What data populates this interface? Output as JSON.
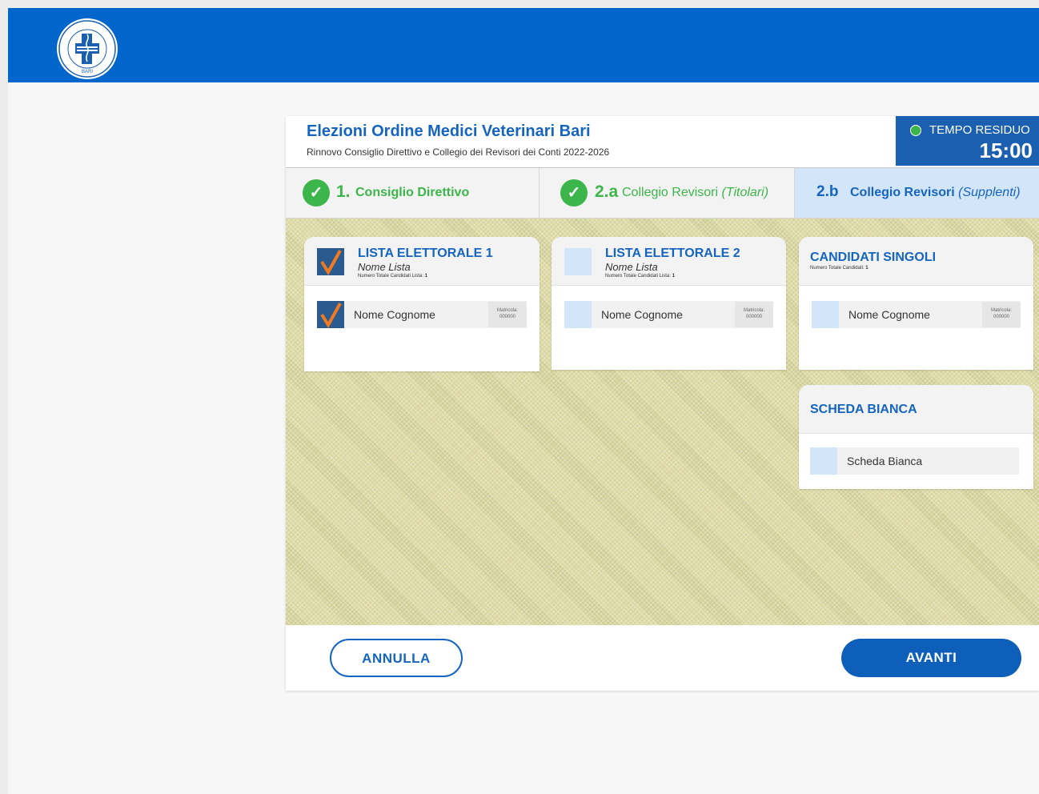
{
  "colors": {
    "brand_blue": "#0066cc",
    "accent_blue": "#1565c0",
    "success_green": "#3cb54a",
    "check_orange": "#f07a20",
    "box_light_blue": "#d3e5f8",
    "box_dark_blue": "#2b5b8e",
    "ballot_background": "#d8d59c"
  },
  "header": {
    "logo_icon": "ordine-medici-veterinari-bari-seal",
    "logo_text": "ORDINE MEDICI VETERINARI PROVINCIA BARI",
    "title": "Elezioni Ordine Medici Veterinari Bari",
    "subtitle": "Rinnovo Consiglio Direttivo e Collegio dei Revisori dei Conti 2022-2026"
  },
  "timer": {
    "status_icon": "status-dot-green",
    "label": "TEMPO RESIDUO",
    "value": "15:00"
  },
  "steps": [
    {
      "icon": "check-circle-icon",
      "number": "1.",
      "label": "Consiglio Direttivo",
      "label_italic": "",
      "status": "completed"
    },
    {
      "icon": "check-circle-icon",
      "number": "2.a",
      "label": "Collegio Revisori",
      "label_italic": "(Titolari)",
      "status": "completed"
    },
    {
      "icon": "",
      "number": "2.b",
      "label": "Collegio Revisori",
      "label_italic": "(Supplenti)",
      "status": "active"
    }
  ],
  "lists": [
    {
      "title": "LISTA ELETTORALE 1",
      "name": "Nome Lista",
      "count_label": "Numero Totale Candidati Lista:",
      "count_value": "1",
      "checked": true,
      "candidates": [
        {
          "name": "Nome Cognome",
          "matricola_label": "Matricola:",
          "matricola_value": "000000",
          "checked": true
        }
      ]
    },
    {
      "title": "LISTA ELETTORALE 2",
      "name": "Nome Lista",
      "count_label": "Numero Totale Candidati Lista:",
      "count_value": "1",
      "checked": false,
      "candidates": [
        {
          "name": "Nome Cognome",
          "matricola_label": "Matricola:",
          "matricola_value": "000000",
          "checked": false
        }
      ]
    }
  ],
  "singles": {
    "title": "CANDIDATI SINGOLI",
    "count_label": "Numero Totale Candidati:",
    "count_value": "1",
    "candidates": [
      {
        "name": "Nome Cognome",
        "matricola_label": "Matricola:",
        "matricola_value": "000000",
        "checked": false
      }
    ]
  },
  "blank": {
    "title": "SCHEDA BIANCA",
    "option_label": "Scheda Bianca",
    "checked": false
  },
  "footer": {
    "cancel_label": "ANNULLA",
    "next_label": "AVANTI"
  }
}
